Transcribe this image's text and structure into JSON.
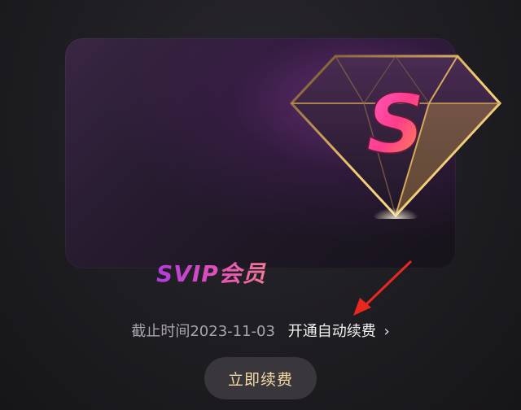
{
  "card": {
    "title": "SVIP会员",
    "badge_letter": "S"
  },
  "expiry": {
    "text": "截止时间2023-11-03",
    "auto_renew_link": "开通自动续费",
    "chevron": "›"
  },
  "actions": {
    "renew_now": "立即续费"
  },
  "colors": {
    "accent_gold": "#f3d9a4",
    "brand_pink": "#e34fb8",
    "arrow_red": "#e8281e"
  },
  "icons": [
    "diamond-icon",
    "chevron-right-icon",
    "arrow-annotation-icon"
  ]
}
